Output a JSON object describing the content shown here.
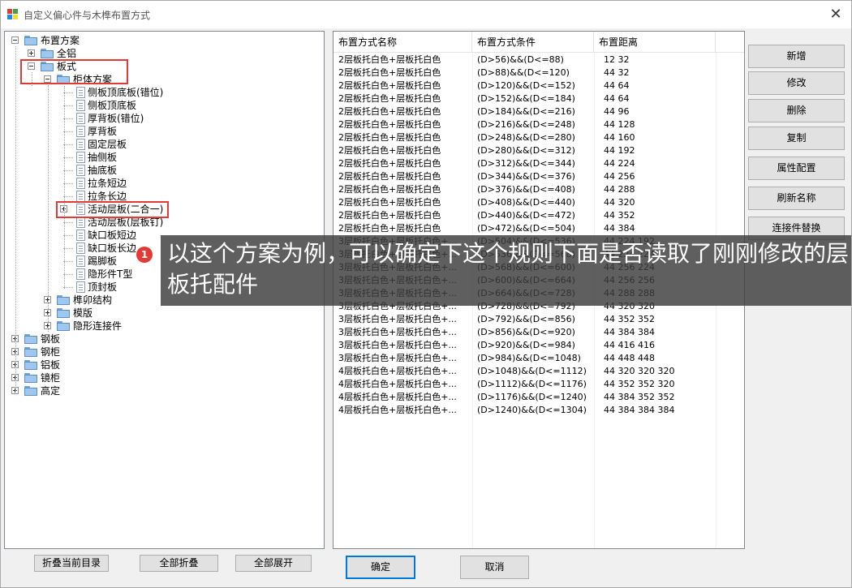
{
  "window": {
    "title": "自定义偏心件与木榫布置方式"
  },
  "tree": {
    "rows": [
      {
        "label": "布置方案",
        "level": 0,
        "type": "folder",
        "expander": "minus"
      },
      {
        "label": "全铝",
        "level": 1,
        "type": "folder",
        "expander": "plus"
      },
      {
        "label": "板式",
        "level": 1,
        "type": "folder",
        "expander": "minus"
      },
      {
        "label": "柜体方案",
        "level": 2,
        "type": "folder",
        "expander": "minus"
      },
      {
        "label": "侧板顶底板(错位)",
        "level": 3,
        "type": "doc"
      },
      {
        "label": "侧板顶底板",
        "level": 3,
        "type": "doc"
      },
      {
        "label": "厚背板(错位)",
        "level": 3,
        "type": "doc"
      },
      {
        "label": "厚背板",
        "level": 3,
        "type": "doc"
      },
      {
        "label": "固定层板",
        "level": 3,
        "type": "doc"
      },
      {
        "label": "抽侧板",
        "level": 3,
        "type": "doc"
      },
      {
        "label": "抽底板",
        "level": 3,
        "type": "doc"
      },
      {
        "label": "拉条短边",
        "level": 3,
        "type": "doc"
      },
      {
        "label": "拉条长边",
        "level": 3,
        "type": "doc"
      },
      {
        "label": "活动层板(二合一)",
        "level": 3,
        "type": "doc",
        "expander": "plus"
      },
      {
        "label": "活动层板(层板钉)",
        "level": 3,
        "type": "doc"
      },
      {
        "label": "缺口板短边",
        "level": 3,
        "type": "doc"
      },
      {
        "label": "缺口板长边",
        "level": 3,
        "type": "doc"
      },
      {
        "label": "踢脚板",
        "level": 3,
        "type": "doc"
      },
      {
        "label": "隐形件T型",
        "level": 3,
        "type": "doc"
      },
      {
        "label": "顶封板",
        "level": 3,
        "type": "doc"
      },
      {
        "label": "榫卯结构",
        "level": 2,
        "type": "folder",
        "expander": "plus"
      },
      {
        "label": "模版",
        "level": 2,
        "type": "folder",
        "expander": "plus"
      },
      {
        "label": "隐形连接件",
        "level": 2,
        "type": "folder",
        "expander": "plus"
      },
      {
        "label": "钢板",
        "level": 0,
        "type": "folder",
        "expander": "plus"
      },
      {
        "label": "钢柜",
        "level": 0,
        "type": "folder",
        "expander": "plus"
      },
      {
        "label": "铝板",
        "level": 0,
        "type": "folder",
        "expander": "plus"
      },
      {
        "label": "镜柜",
        "level": 0,
        "type": "folder",
        "expander": "plus"
      },
      {
        "label": "高定",
        "level": 0,
        "type": "folder",
        "expander": "plus"
      }
    ]
  },
  "list": {
    "columns": [
      "布置方式名称",
      "布置方式条件",
      "布置距离"
    ],
    "rows": [
      [
        "2层板托白色+层板托白色",
        "(D>56)&&(D<=88)",
        "12 32"
      ],
      [
        "2层板托白色+层板托白色",
        "(D>88)&&(D<=120)",
        "44 32"
      ],
      [
        "2层板托白色+层板托白色",
        "(D>120)&&(D<=152)",
        "44 64"
      ],
      [
        "2层板托白色+层板托白色",
        "(D>152)&&(D<=184)",
        "44 64"
      ],
      [
        "2层板托白色+层板托白色",
        "(D>184)&&(D<=216)",
        "44 96"
      ],
      [
        "2层板托白色+层板托白色",
        "(D>216)&&(D<=248)",
        "44 128"
      ],
      [
        "2层板托白色+层板托白色",
        "(D>248)&&(D<=280)",
        "44 160"
      ],
      [
        "2层板托白色+层板托白色",
        "(D>280)&&(D<=312)",
        "44 192"
      ],
      [
        "2层板托白色+层板托白色",
        "(D>312)&&(D<=344)",
        "44 224"
      ],
      [
        "2层板托白色+层板托白色",
        "(D>344)&&(D<=376)",
        "44 256"
      ],
      [
        "2层板托白色+层板托白色",
        "(D>376)&&(D<=408)",
        "44 288"
      ],
      [
        "2层板托白色+层板托白色",
        "(D>408)&&(D<=440)",
        "44 320"
      ],
      [
        "2层板托白色+层板托白色",
        "(D>440)&&(D<=472)",
        "44 352"
      ],
      [
        "2层板托白色+层板托白色",
        "(D>472)&&(D<=504)",
        "44 384"
      ],
      [
        "3层板托白色+层板托白色+...",
        "(D>504)&&(D<=536)",
        "44 224 192"
      ],
      [
        "3层板托白色+层板托白色+...",
        "(D>536)&&(D<=568)",
        "44 224 224"
      ],
      [
        "3层板托白色+层板托白色+...",
        "(D>568)&&(D<=600)",
        "44 256 224"
      ],
      [
        "3层板托白色+层板托白色+...",
        "(D>600)&&(D<=664)",
        "44 256 256"
      ],
      [
        "3层板托白色+层板托白色+...",
        "(D>664)&&(D<=728)",
        "44 288 288"
      ],
      [
        "3层板托白色+层板托白色+...",
        "(D>728)&&(D<=792)",
        "44 320 320"
      ],
      [
        "3层板托白色+层板托白色+...",
        "(D>792)&&(D<=856)",
        "44 352 352"
      ],
      [
        "3层板托白色+层板托白色+...",
        "(D>856)&&(D<=920)",
        "44 384 384"
      ],
      [
        "3层板托白色+层板托白色+...",
        "(D>920)&&(D<=984)",
        "44 416 416"
      ],
      [
        "3层板托白色+层板托白色+...",
        "(D>984)&&(D<=1048)",
        "44 448 448"
      ],
      [
        "4层板托白色+层板托白色+...",
        "(D>1048)&&(D<=1112)",
        "44 320 320 320"
      ],
      [
        "4层板托白色+层板托白色+...",
        "(D>1112)&&(D<=1176)",
        "44 352 352 320"
      ],
      [
        "4层板托白色+层板托白色+...",
        "(D>1176)&&(D<=1240)",
        "44 384 352 352"
      ],
      [
        "4层板托白色+层板托白色+...",
        "(D>1240)&&(D<=1304)",
        "44 384 384 384"
      ]
    ]
  },
  "side_buttons": {
    "add": "新增",
    "edit": "修改",
    "delete": "删除",
    "copy": "复制",
    "attr_config": "属性配置",
    "refresh_name": "刷新名称",
    "connector_replace": "连接件替换"
  },
  "bottom_buttons": {
    "collapse_current": "折叠当前目录",
    "collapse_all": "全部折叠",
    "expand_all": "全部展开",
    "ok": "确定",
    "cancel": "取消"
  },
  "annotation": {
    "marker": "1",
    "text": "以这个方案为例，可以确定下这个规则下面是否读取了刚刚修改的层板托配件"
  },
  "colors": {
    "highlight_box": "#e53935",
    "default_button_border": "#0078d7",
    "callout_bg": "#3c3c3c"
  }
}
